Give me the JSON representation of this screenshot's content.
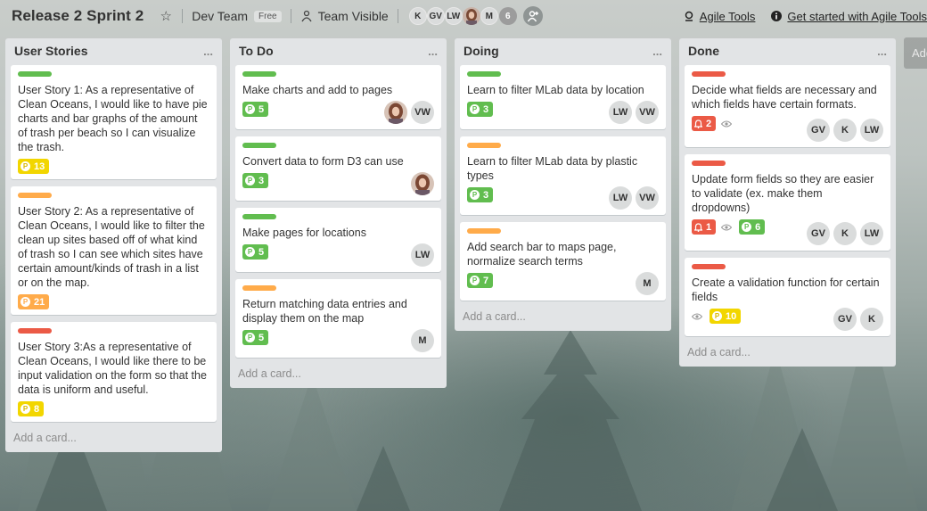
{
  "board": {
    "title": "Release 2 Sprint 2",
    "team": "Dev Team",
    "team_badge": "Free",
    "visibility": "Team Visible",
    "members": [
      "K",
      "GV",
      "LW",
      "M"
    ],
    "member_count": "6",
    "links": {
      "agile_tools": "Agile Tools",
      "get_started": "Get started with Agile Tools"
    },
    "add_list": "Add"
  },
  "colors": {
    "green": "#61bd4f",
    "orange": "#ffab4a",
    "red": "#eb5a46",
    "yellow": "#f2d600"
  },
  "lists": [
    {
      "title": "User Stories",
      "menu": "...",
      "add_card": "Add a card...",
      "cards": [
        {
          "label": "green",
          "title": "User Story 1: As a representative of Clean Oceans, I would like to have pie charts and bar graphs of the amount of trash per beach so I can visualize the trash.",
          "points": "13",
          "points_color": "yellow",
          "members": []
        },
        {
          "label": "orange",
          "title": "User Story 2: As a representative of Clean Oceans, I would like to filter the clean up sites based off of what kind of trash so I can see which sites have certain amount/kinds of trash in a list or on the map.",
          "points": "21",
          "points_color": "orange",
          "members": []
        },
        {
          "label": "red",
          "title": "User Story 3:As a representative of Clean Oceans, I would like there to be input validation on the form so that the data is uniform and useful.",
          "points": "8",
          "points_color": "yellow",
          "members": []
        }
      ]
    },
    {
      "title": "To Do",
      "menu": "...",
      "add_card": "Add a card...",
      "cards": [
        {
          "label": "green",
          "title": "Make charts and add to pages",
          "points": "5",
          "points_color": "green",
          "members": [
            "photo",
            "VW"
          ]
        },
        {
          "label": "green",
          "title": "Convert data to form D3 can use",
          "points": "3",
          "points_color": "green",
          "members": [
            "photo"
          ]
        },
        {
          "label": "green",
          "title": "Make pages for locations",
          "points": "5",
          "points_color": "green",
          "members": [
            "LW"
          ]
        },
        {
          "label": "orange",
          "title": "Return matching data entries and display them on the map",
          "points": "5",
          "points_color": "green",
          "members": [
            "M"
          ]
        }
      ]
    },
    {
      "title": "Doing",
      "menu": "...",
      "add_card": "Add a card...",
      "cards": [
        {
          "label": "green",
          "title": "Learn to filter MLab data by location",
          "points": "3",
          "points_color": "green",
          "members": [
            "LW",
            "VW"
          ]
        },
        {
          "label": "orange",
          "title": "Learn to filter MLab data by plastic types",
          "points": "3",
          "points_color": "green",
          "members": [
            "LW",
            "VW"
          ]
        },
        {
          "label": "orange",
          "title": "Add search bar to maps page, normalize search terms",
          "points": "7",
          "points_color": "green",
          "members": [
            "M"
          ]
        }
      ]
    },
    {
      "title": "Done",
      "menu": "...",
      "add_card": "Add a card...",
      "cards": [
        {
          "label": "red",
          "title": "Decide what fields are necessary and which fields have certain formats.",
          "alert": "2",
          "watch": true,
          "members": [
            "GV",
            "K",
            "LW"
          ]
        },
        {
          "label": "red",
          "title": "Update form fields so they are easier to validate (ex. make them dropdowns)",
          "alert": "1",
          "watch": true,
          "points": "6",
          "points_color": "green",
          "members": [
            "GV",
            "K",
            "LW"
          ]
        },
        {
          "label": "red",
          "title": "Create a validation function for certain fields",
          "watch": true,
          "points": "10",
          "points_color": "yellow",
          "members": [
            "GV",
            "K"
          ]
        }
      ]
    }
  ]
}
